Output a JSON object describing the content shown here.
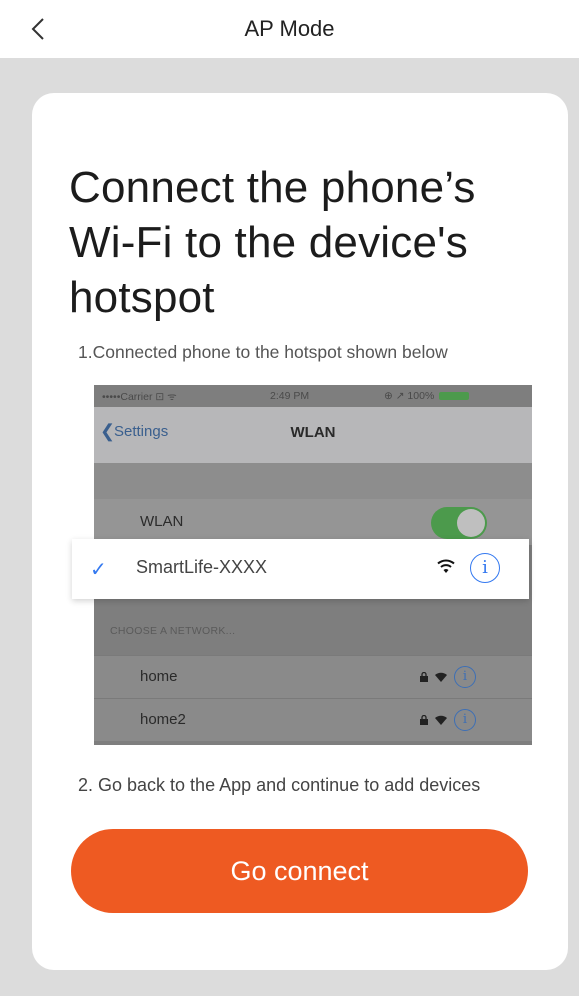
{
  "header": {
    "title": "AP Mode",
    "back_icon": "chevron-left-icon"
  },
  "card": {
    "title": "Connect the phone’s Wi-Fi to the device's hotspot",
    "step1": "1.Connected phone to the hotspot shown below",
    "step2": "2. Go back to the App and continue to add devices",
    "button_label": "Go connect"
  },
  "phone_screenshot": {
    "status_left": "•••••Carrier ⊡ ᯤ",
    "status_time": "2:49 PM",
    "status_right": "⊕ ↗ 100%",
    "back_label": "Settings",
    "nav_title": "WLAN",
    "wlan_label": "WLAN",
    "wlan_enabled": true,
    "selected_network": "SmartLife-XXXX",
    "choose_label": "CHOOSE A NETWORK...",
    "networks": [
      {
        "name": "home"
      },
      {
        "name": "home2"
      }
    ]
  },
  "colors": {
    "accent": "#ee5a22",
    "check": "#3479f0",
    "background": "#dcdcdc"
  }
}
